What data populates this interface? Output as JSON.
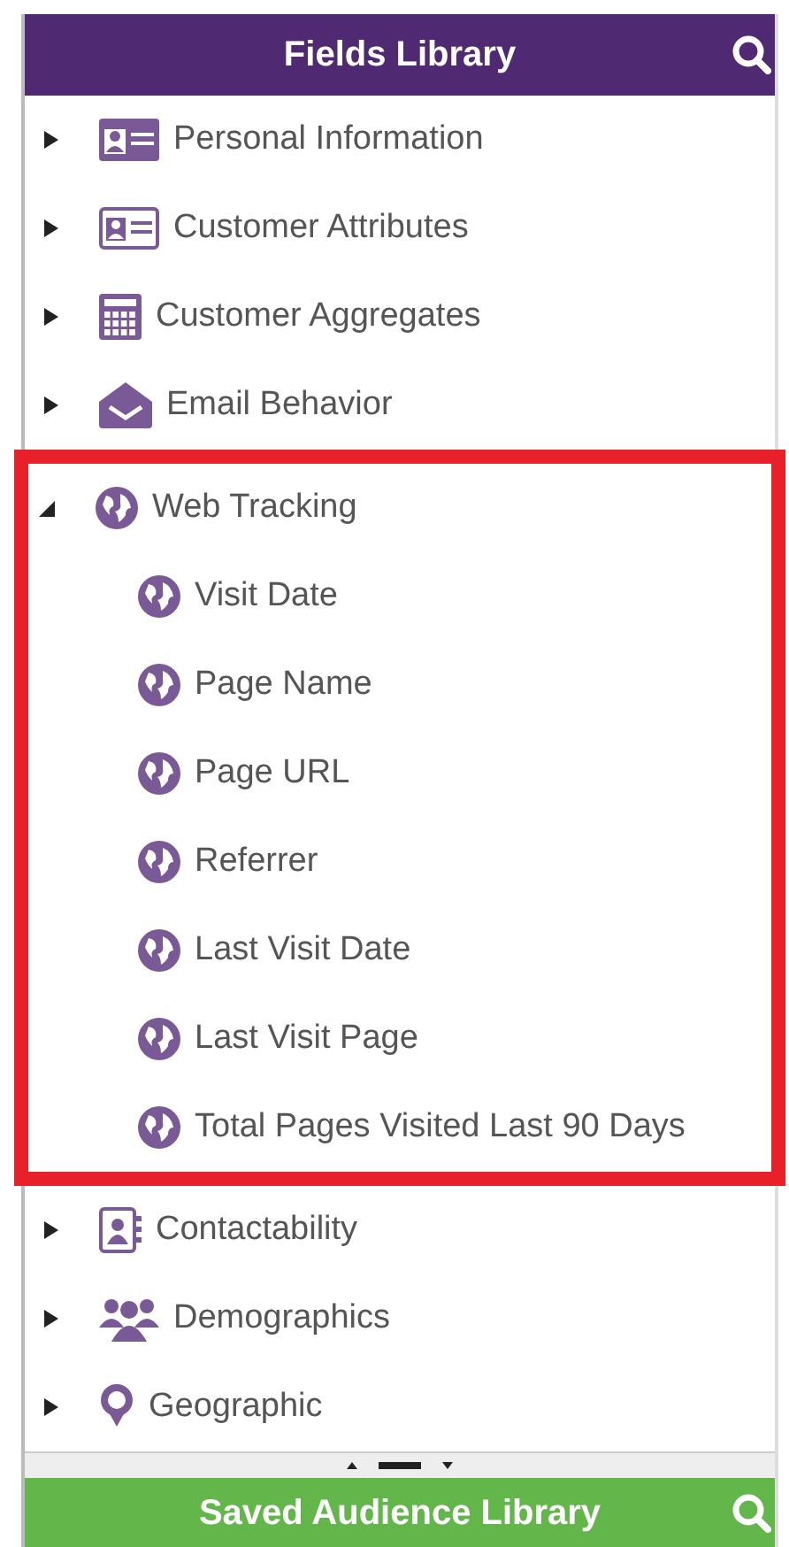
{
  "header": {
    "title": "Fields Library"
  },
  "tree": [
    {
      "label": "Personal Information",
      "expanded": false,
      "highlighted": false
    },
    {
      "label": "Customer Attributes",
      "expanded": false,
      "highlighted": false
    },
    {
      "label": "Customer Aggregates",
      "expanded": false,
      "highlighted": false
    },
    {
      "label": "Email Behavior",
      "expanded": false,
      "highlighted": false
    },
    {
      "label": "Web Tracking",
      "expanded": true,
      "highlighted": true,
      "children": [
        {
          "label": "Visit Date"
        },
        {
          "label": "Page Name"
        },
        {
          "label": "Page URL"
        },
        {
          "label": "Referrer"
        },
        {
          "label": "Last Visit Date"
        },
        {
          "label": "Last Visit Page"
        },
        {
          "label": "Total Pages Visited Last 90 Days"
        }
      ]
    },
    {
      "label": "Contactability",
      "expanded": false,
      "highlighted": false
    },
    {
      "label": "Demographics",
      "expanded": false,
      "highlighted": false
    },
    {
      "label": "Geographic",
      "expanded": false,
      "highlighted": false
    }
  ],
  "footer": {
    "title": "Saved Audience Library"
  }
}
